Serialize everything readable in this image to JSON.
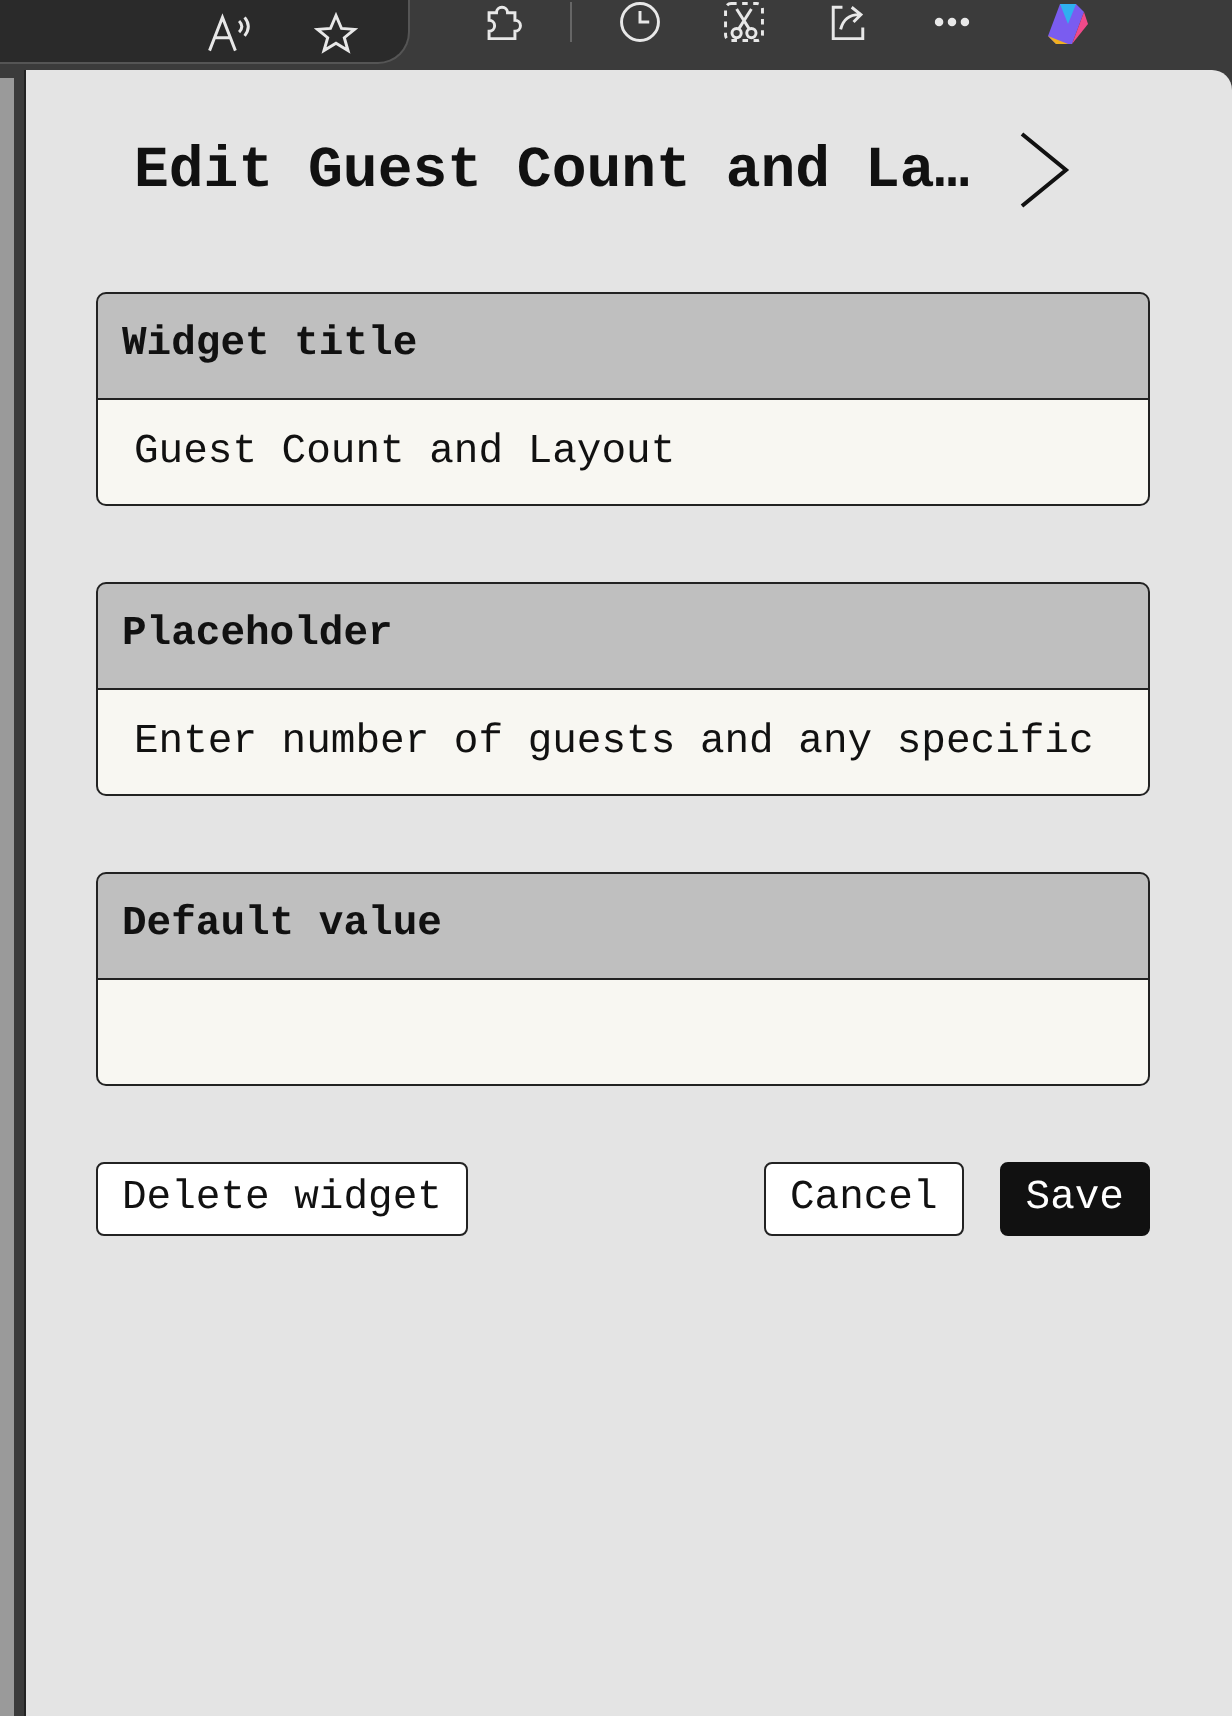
{
  "panel": {
    "title": "Edit Guest Count and La…",
    "fields": [
      {
        "label": "Widget title",
        "value": "Guest Count and Layout"
      },
      {
        "label": "Placeholder",
        "value": "Enter number of guests and any specific"
      },
      {
        "label": "Default value"
      }
    ],
    "buttons": [
      {
        "label": "Delete widget",
        "kind": "outline"
      },
      {
        "label": "Cancel",
        "kind": "outline"
      },
      {
        "label": "Save",
        "kind": "primary"
      }
    ]
  }
}
